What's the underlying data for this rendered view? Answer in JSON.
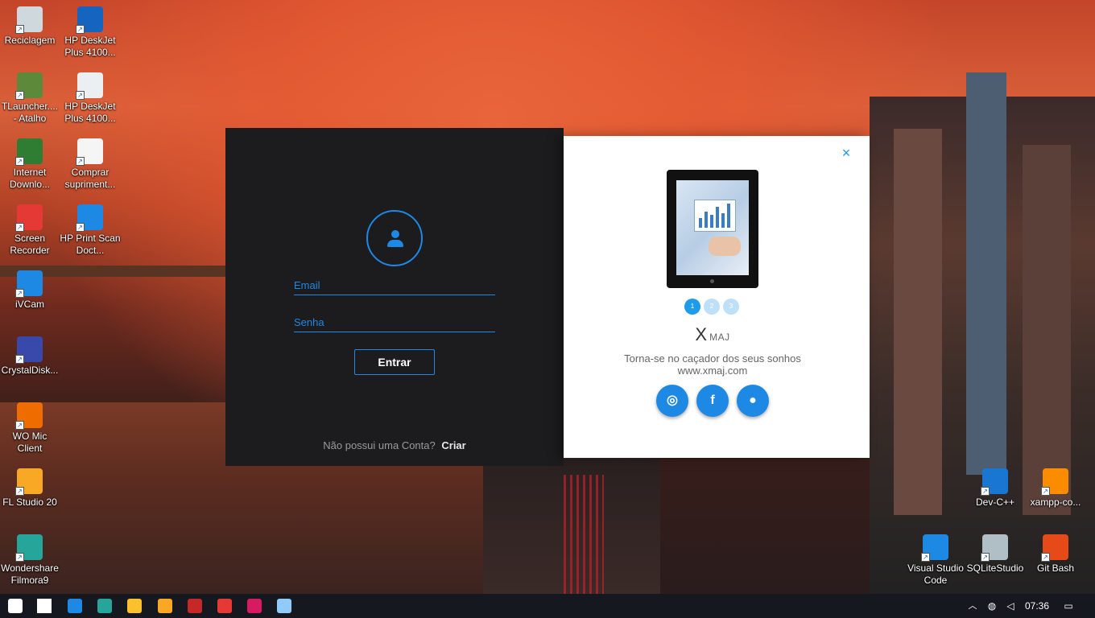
{
  "desktop": {
    "left_icons": [
      {
        "label": "Reciclagem",
        "icon": "recycle-bin-icon",
        "color": "#cfd8dc"
      },
      {
        "label": "TLauncher.... - Atalho",
        "icon": "minecraft-icon",
        "color": "#5d8a3a"
      },
      {
        "label": "Internet Downlo...",
        "icon": "idm-icon",
        "color": "#2e7d32"
      },
      {
        "label": "Screen Recorder",
        "icon": "screen-recorder-icon",
        "color": "#e53935"
      },
      {
        "label": "iVCam",
        "icon": "ivcam-icon",
        "color": "#1e88e5"
      },
      {
        "label": "CrystalDisk...",
        "icon": "crystaldisk-icon",
        "color": "#3949ab"
      },
      {
        "label": "WO Mic Client",
        "icon": "microphone-icon",
        "color": "#ef6c00"
      },
      {
        "label": "FL Studio 20",
        "icon": "fl-studio-icon",
        "color": "#f9a825"
      },
      {
        "label": "Wondershare Filmora9",
        "icon": "filmora-icon",
        "color": "#26a69a"
      }
    ],
    "second_column_icons": [
      {
        "label": "HP DeskJet Plus 4100...",
        "icon": "printer-icon",
        "color": "#1565c0"
      },
      {
        "label": "HP DeskJet Plus 4100...",
        "icon": "printer-icon",
        "color": "#eceff1"
      },
      {
        "label": "Comprar supriment...",
        "icon": "printer-supplies-icon",
        "color": "#f5f5f5"
      },
      {
        "label": "HP Print Scan Doct...",
        "icon": "print-scan-icon",
        "color": "#1e88e5"
      }
    ],
    "right_icons": [
      {
        "label": "Dev-C++",
        "icon": "devcpp-icon",
        "color": "#1976d2"
      },
      {
        "label": "xampp-co...",
        "icon": "xampp-icon",
        "color": "#fb8c00"
      },
      {
        "label": "Visual Studio Code",
        "icon": "vscode-icon",
        "color": "#1e88e5"
      },
      {
        "label": "SQLiteStudio",
        "icon": "database-icon",
        "color": "#b0bec5"
      },
      {
        "label": "Git Bash",
        "icon": "git-icon",
        "color": "#e64a19"
      }
    ]
  },
  "login": {
    "email_placeholder": "Email",
    "password_placeholder": "Senha",
    "submit_label": "Entrar",
    "signup_prompt": "Não possui uma Conta?",
    "signup_link": "Criar",
    "accent_color": "#1e88e5"
  },
  "promo": {
    "close_label": "×",
    "carousel_dots": [
      {
        "label": "1",
        "active": true,
        "color": "#1e9be9"
      },
      {
        "label": "2",
        "active": false,
        "color": "#bde0f7"
      },
      {
        "label": "3",
        "active": false,
        "color": "#bde0f7"
      }
    ],
    "brand_x": "X",
    "brand_name": "MAJ",
    "tagline": "Torna-se no caçador dos seus sonhos",
    "website": "www.xmaj.com",
    "social": [
      {
        "name": "instagram-icon",
        "glyph": "◎"
      },
      {
        "name": "facebook-icon",
        "glyph": "f"
      },
      {
        "name": "github-icon",
        "glyph": "●"
      }
    ]
  },
  "taskbar": {
    "apps": [
      {
        "name": "start-icon",
        "color": "#ffffff"
      },
      {
        "name": "task-view-icon",
        "color": "#ffffff"
      },
      {
        "name": "vscode-taskbar-icon",
        "color": "#1e88e5"
      },
      {
        "name": "edge-icon",
        "color": "#26a69a"
      },
      {
        "name": "file-explorer-icon",
        "color": "#fbc02d"
      },
      {
        "name": "app-yellow-icon",
        "color": "#f9a825"
      },
      {
        "name": "access-icon",
        "color": "#c62828"
      },
      {
        "name": "stack-app-icon",
        "color": "#e53935"
      },
      {
        "name": "app-pink-icon",
        "color": "#d81b60"
      },
      {
        "name": "window-app-icon",
        "color": "#90caf9"
      }
    ],
    "time": "07:36"
  }
}
